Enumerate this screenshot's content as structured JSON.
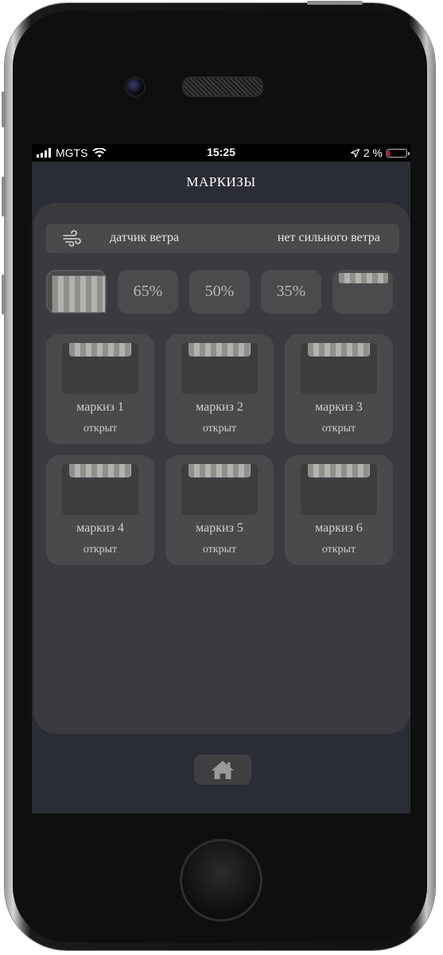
{
  "status_bar": {
    "carrier": "MGTS",
    "time": "15:25",
    "battery": "2 %",
    "icons": [
      "signal-icon",
      "wifi-icon",
      "location-arrow-icon",
      "battery-icon"
    ]
  },
  "header": {
    "title": "МАРКИЗЫ"
  },
  "wind_sensor": {
    "icon": "wind-icon",
    "label": "датчик ветра",
    "value": "нет сильного ветра"
  },
  "presets": [
    {
      "label": "",
      "icon": "awning-closed-icon"
    },
    {
      "label": "65%"
    },
    {
      "label": "50%"
    },
    {
      "label": "35%"
    },
    {
      "label": "",
      "icon": "awning-open-icon"
    }
  ],
  "awnings": [
    {
      "name": "маркиз 1",
      "status": "открыт"
    },
    {
      "name": "маркиз 2",
      "status": "открыт"
    },
    {
      "name": "маркиз 3",
      "status": "открыт"
    },
    {
      "name": "маркиз 4",
      "status": "открыт"
    },
    {
      "name": "маркиз 5",
      "status": "открыт"
    },
    {
      "name": "маркиз 6",
      "status": "открыт"
    }
  ],
  "nav": {
    "home_icon": "home-icon"
  },
  "colors": {
    "screen_bg": "#2a2d35",
    "panel_bg": "#3b3b3f",
    "card_bg": "#4a4a4c",
    "text": "#cfcfcf",
    "stripe_light": "#b2b2ae",
    "stripe_dark": "#8f8f8c"
  }
}
